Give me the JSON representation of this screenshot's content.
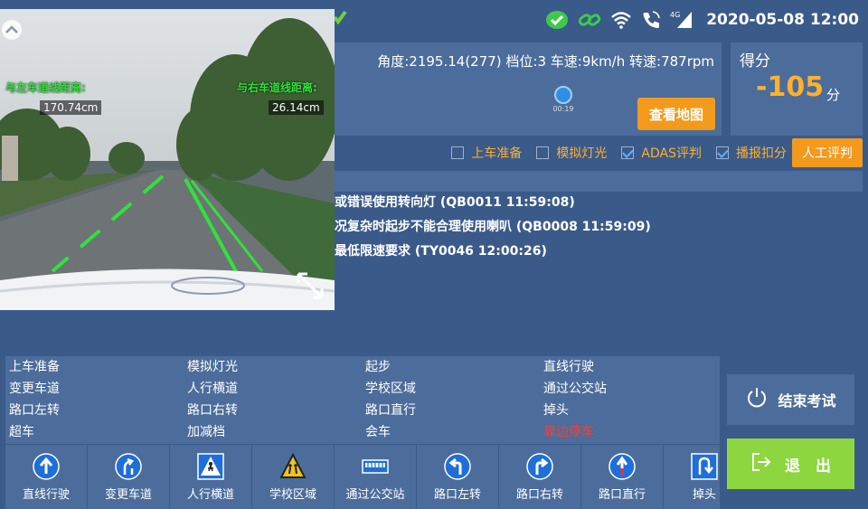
{
  "status": {
    "datetime": "2020-05-08 12:00",
    "network": "4G"
  },
  "camera": {
    "left_label": "与左车道线距离:",
    "left_value": "170.74cm",
    "right_label": "与右车道线距离:",
    "right_value": "26.14cm"
  },
  "info": {
    "line": "角度:2195.14(277) 档位:3 车速:9km/h 转速:787rpm",
    "playback_time": "00:19",
    "map_button": "查看地图"
  },
  "score": {
    "label": "得分",
    "value": "-105",
    "unit": "分"
  },
  "options": [
    {
      "label": "上车准备",
      "checked": false
    },
    {
      "label": "模拟灯光",
      "checked": false
    },
    {
      "label": "ADAS评判",
      "checked": true
    },
    {
      "label": "播报扣分",
      "checked": true
    }
  ],
  "manual_button": "人工评判",
  "messages": [
    "或错误使用转向灯 (QB0011  11:59:08)",
    "况复杂时起步不能合理使用喇叭 (QB0008  11:59:09)",
    "最低限速要求 (TY0046  12:00:26)"
  ],
  "items": [
    {
      "label": "上车准备",
      "highlight": false
    },
    {
      "label": "模拟灯光",
      "highlight": false
    },
    {
      "label": "起步",
      "highlight": false
    },
    {
      "label": "直线行驶",
      "highlight": false
    },
    {
      "label": "变更车道",
      "highlight": false
    },
    {
      "label": "人行横道",
      "highlight": false
    },
    {
      "label": "学校区域",
      "highlight": false
    },
    {
      "label": "通过公交站",
      "highlight": false
    },
    {
      "label": "路口左转",
      "highlight": false
    },
    {
      "label": "路口右转",
      "highlight": false
    },
    {
      "label": "路口直行",
      "highlight": false
    },
    {
      "label": "掉头",
      "highlight": false
    },
    {
      "label": "超车",
      "highlight": false
    },
    {
      "label": "加减档",
      "highlight": false
    },
    {
      "label": "会车",
      "highlight": false
    },
    {
      "label": "靠边停车",
      "highlight": true
    }
  ],
  "bottom_buttons": [
    {
      "label": "直线行驶",
      "icon": "straight-arrow-icon"
    },
    {
      "label": "变更车道",
      "icon": "lane-change-icon"
    },
    {
      "label": "人行横道",
      "icon": "crosswalk-icon"
    },
    {
      "label": "学校区域",
      "icon": "school-zone-icon"
    },
    {
      "label": "通过公交站",
      "icon": "bus-stop-icon"
    },
    {
      "label": "路口左转",
      "icon": "turn-left-icon"
    },
    {
      "label": "路口右转",
      "icon": "turn-right-icon"
    },
    {
      "label": "路口直行",
      "icon": "go-straight-icon"
    },
    {
      "label": "掉头",
      "icon": "u-turn-icon"
    }
  ],
  "end_button": "结束考试",
  "exit_button": "退　出",
  "colors": {
    "background": "#3a5a8a",
    "panel": "#4c6d9b",
    "accent_orange": "#f39a1c",
    "score_orange": "#ffb02e",
    "exit_green": "#8dd63f",
    "alert_red": "#ff3b2f",
    "lane_green": "#2fe33a"
  }
}
